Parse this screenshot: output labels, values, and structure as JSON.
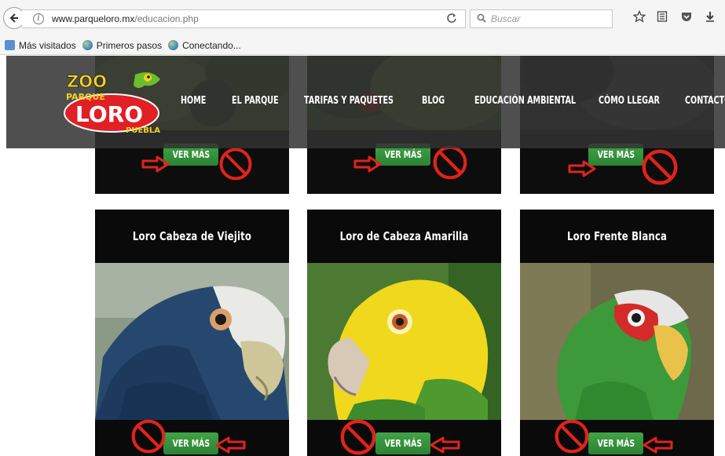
{
  "browser": {
    "url_domain": "www.parqueloro.mx",
    "url_path": "/educacion.php",
    "search_placeholder": "Buscar",
    "bookmarks": [
      "Más visitados",
      "Primeros pasos",
      "Conectando..."
    ]
  },
  "site": {
    "logo": {
      "line1": "ZOO",
      "line2": "PARQUE",
      "line3": "LORO",
      "line4": "PUEBLA"
    },
    "nav": [
      "HOME",
      "EL PARQUE",
      "TARIFAS Y PAQUETES",
      "BLOG",
      "EDUCACIÓN AMBIENTAL",
      "CÓMO LLEGAR",
      "CONTACTO"
    ],
    "button_label": "VER MÁS",
    "cards": [
      {
        "title": "Loro Cabeza de Viejito",
        "icon": "blue-headed-parrot-photo"
      },
      {
        "title": "Loro de Cabeza Amarilla",
        "icon": "yellow-headed-parrot-photo"
      },
      {
        "title": "Loro Frente Blanca",
        "icon": "white-fronted-parrot-photo"
      }
    ]
  },
  "colors": {
    "button_green": "#36953c",
    "annotation_red": "#e2231a",
    "card_bg": "#0a0a0a",
    "header_bg": "#323232"
  }
}
